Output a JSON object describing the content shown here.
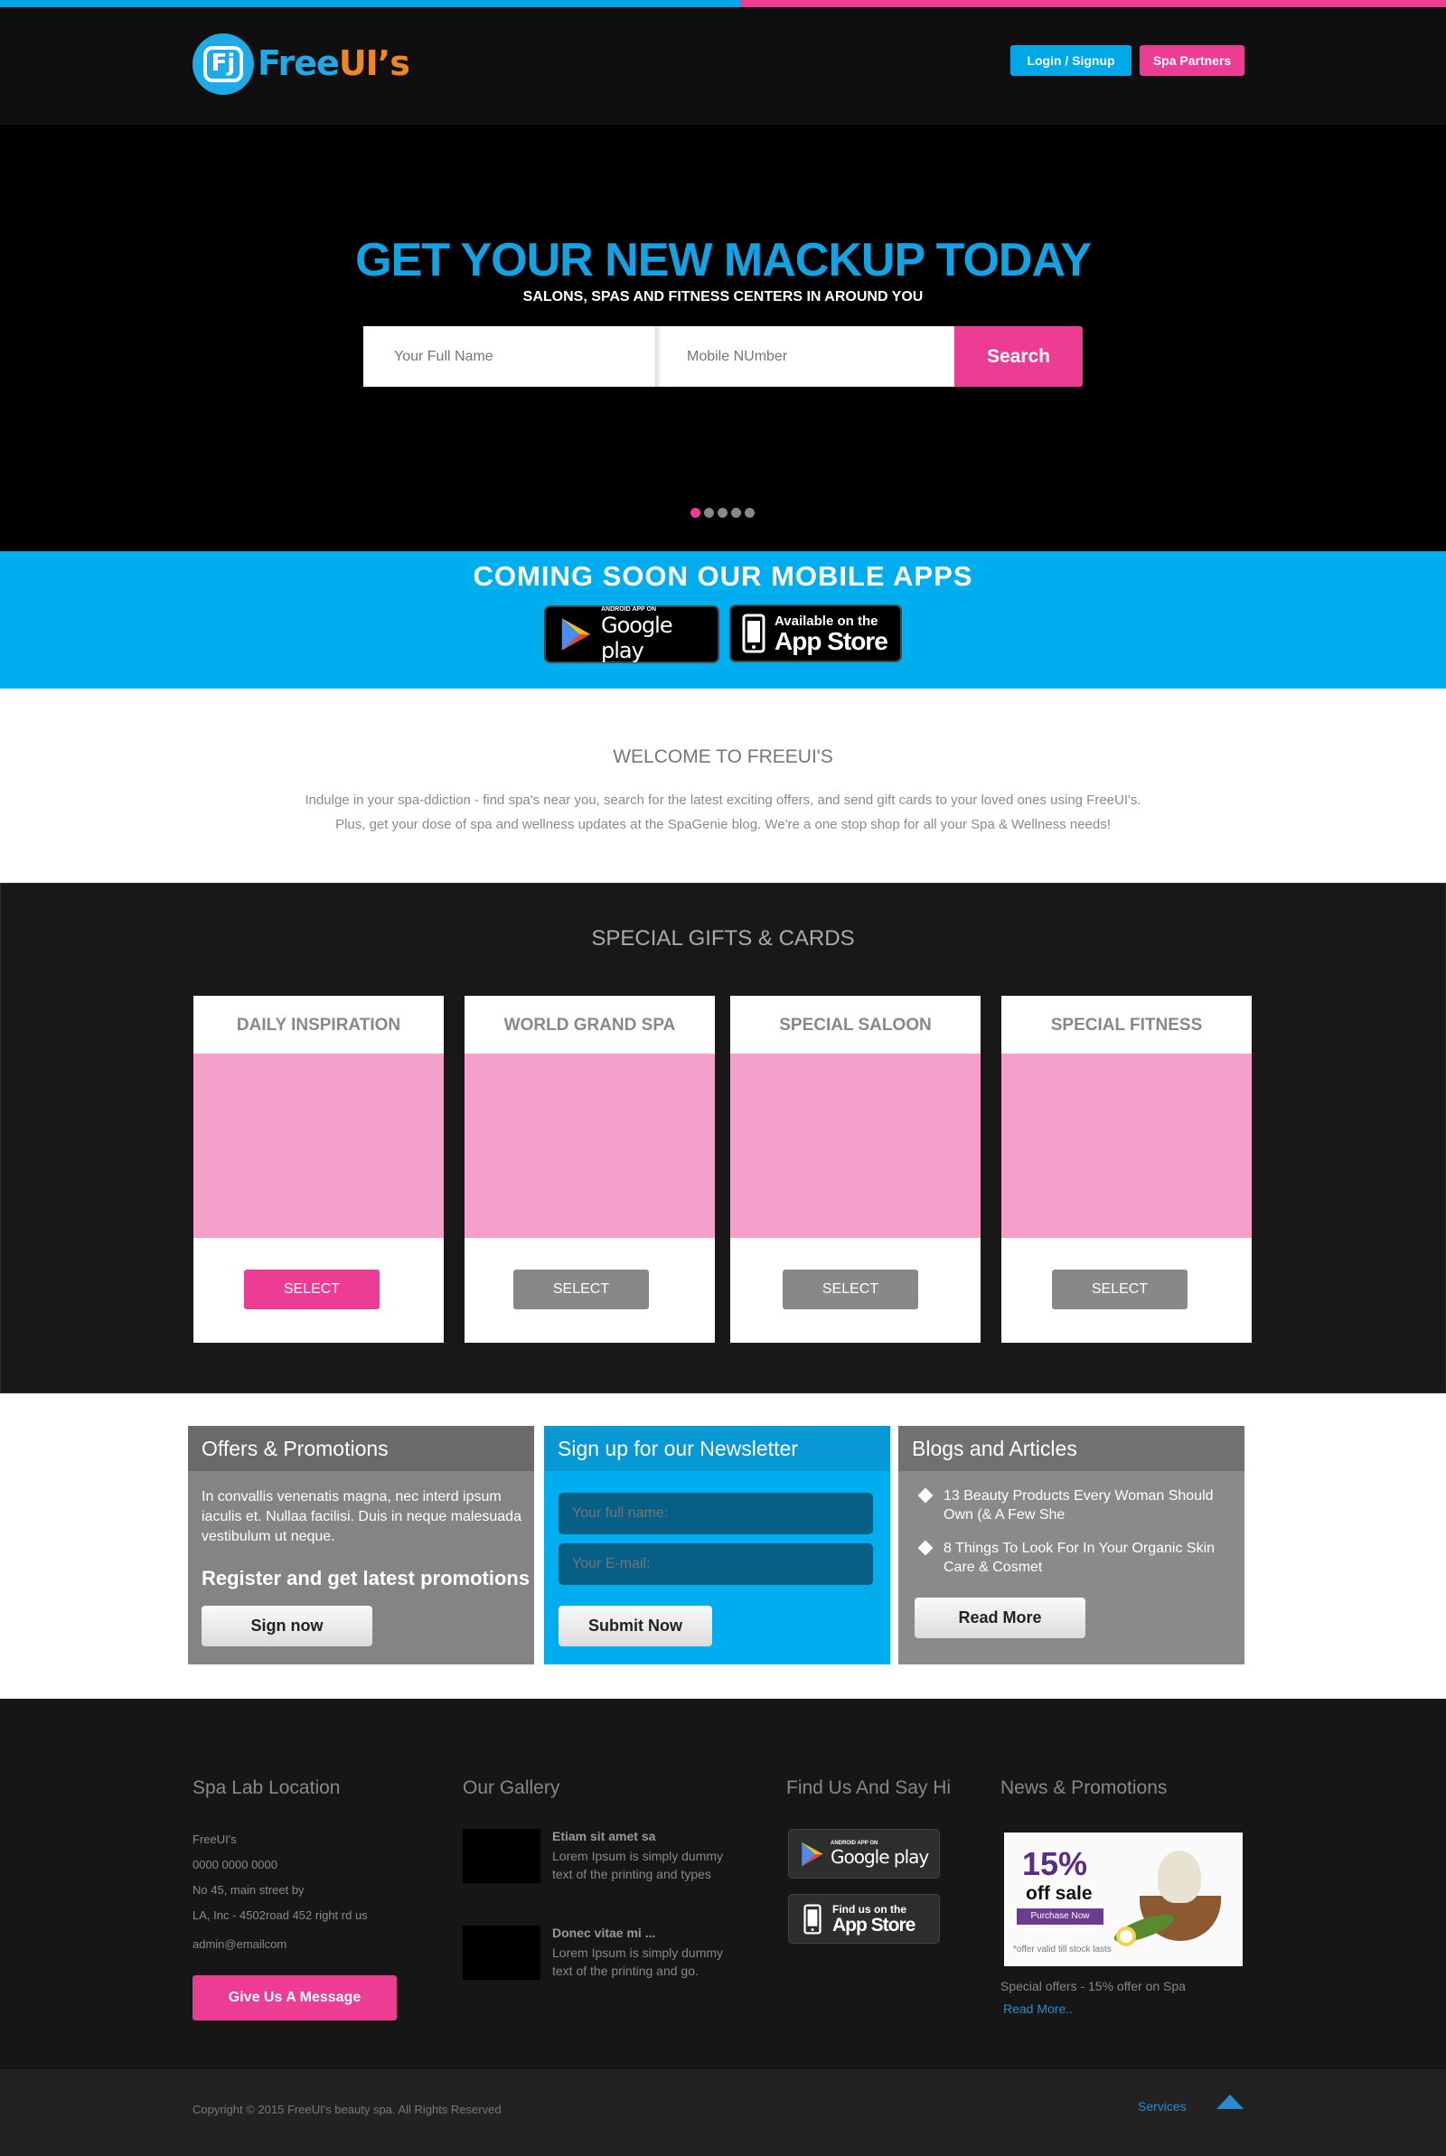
{
  "brand": {
    "logo_mark": "Fj",
    "name_part1": "Free",
    "name_part2": "UI’s",
    "primary": "#00aeef",
    "accent": "#ec3c94"
  },
  "header": {
    "login_label": "Login / Signup",
    "partners_label": "Spa Partners"
  },
  "hero": {
    "title": "GET YOUR NEW MACKUP TODAY",
    "subtitle": "SALONS, SPAS AND FITNESS CENTERS IN  AROUND YOU",
    "name_placeholder": "Your Full Name",
    "mobile_placeholder": "Mobile NUmber",
    "search_label": "Search",
    "slides": 5,
    "active_slide": 1
  },
  "apps": {
    "title": "COMING SOON OUR MOBILE APPS",
    "google_small": "ANDROID APP ON",
    "google_big": "Google play",
    "apple_small": "Available on the",
    "apple_big": "App Store"
  },
  "welcome": {
    "title": "WELCOME TO FREEUI'S",
    "line1": "Indulge in your spa-ddiction - find spa's near you, search for the latest exciting offers, and send gift cards to your loved ones using FreeUI's.",
    "line2": "Plus, get your dose of spa and wellness updates at the SpaGenie blog. We're a one stop shop for all your Spa & Wellness needs!"
  },
  "gifts": {
    "title": "SPECIAL GIFTS & CARDS",
    "cards": [
      {
        "title": "DAILY INSPIRATION",
        "button": "SELECT",
        "selected": true
      },
      {
        "title": "WORLD GRAND SPA",
        "button": "SELECT",
        "selected": false
      },
      {
        "title": "SPECIAL SALOON",
        "button": "SELECT",
        "selected": false
      },
      {
        "title": "SPECIAL FITNESS",
        "button": "SELECT",
        "selected": false
      }
    ]
  },
  "offers": {
    "title": "Offers & Promotions",
    "text": "In convallis venenatis magna, nec interd ipsum iaculis et. Nullaa facilisi. Duis in neque malesuada vestibulum ut neque.",
    "subtitle": "Register and get latest promotions",
    "button": "Sign now"
  },
  "newsletter": {
    "title": "Sign up for our Newsletter",
    "name_placeholder": "Your full name:",
    "email_placeholder": "Your E-mail:",
    "button": "Submit Now"
  },
  "blogs": {
    "title": "Blogs and Articles",
    "items": [
      "13 Beauty Products Every Woman Should Own (& A Few She",
      "8 Things To Look For In Your Organic Skin Care & Cosmet"
    ],
    "button": "Read More"
  },
  "footer": {
    "location": {
      "title": "Spa Lab Location",
      "name": "FreeUI's",
      "phone": "0000 0000 0000",
      "address1": "No 45, main street by",
      "address2": "LA, Inc - 4502road 452 right rd us",
      "email": "admin@emailcom",
      "button": "Give Us A Message"
    },
    "gallery": {
      "title": "Our  Gallery",
      "items": [
        {
          "title": "Etiam sit amet sa",
          "text": "Lorem Ipsum is simply dummy text of the printing and types"
        },
        {
          "title": "Donec vitae mi ...",
          "text": "Lorem Ipsum is simply dummy text of the printing and go."
        }
      ]
    },
    "find": {
      "title": "Find Us And Say Hi",
      "google_small": "ANDROID APP ON",
      "google_big": "Google play",
      "apple_small": "Find us on the",
      "apple_big": "App Store"
    },
    "news": {
      "title": "News & Promotions",
      "promo_big": "15%",
      "promo_sale": "off sale",
      "promo_btn": "Purchase Now",
      "promo_note": "*offer valid till stock lasts",
      "caption": "Special offers - 15% offer on Spa",
      "link": "Read More.."
    }
  },
  "bottom": {
    "copyright": "Copyright © 2015 FreeUI's beauty spa. All Rights Reserved",
    "services": "Services"
  }
}
